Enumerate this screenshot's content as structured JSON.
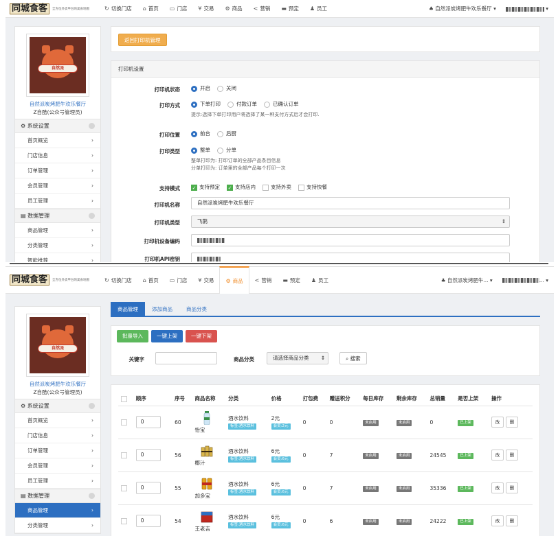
{
  "nav": {
    "logo_text": "同城食客",
    "logo_tagline": "全方位外卖平台的美食地图",
    "items": [
      {
        "icon": "refresh-icon",
        "glyph": "↻",
        "label": "切换门店"
      },
      {
        "icon": "home-icon",
        "glyph": "⌂",
        "label": "首页"
      },
      {
        "icon": "monitor-icon",
        "glyph": "▭",
        "label": "门店"
      },
      {
        "icon": "yen-icon",
        "glyph": "¥",
        "label": "交易"
      },
      {
        "icon": "goods-icon",
        "glyph": "⚙",
        "label": "商品"
      },
      {
        "icon": "share-icon",
        "glyph": "<",
        "label": "营销"
      },
      {
        "icon": "bookmark-icon",
        "glyph": "▬",
        "label": "预定"
      },
      {
        "icon": "user-icon",
        "glyph": "♟",
        "label": "员工"
      }
    ],
    "shop_selector_1": "自然派炭烤肥牛欢乐餐厅",
    "shop_selector_2": "自然派炭烤肥牛...",
    "account_2_visible_suffix": "..."
  },
  "sidebar": {
    "avatar_label": "自然派",
    "shop_name": "自然派炭烤肥牛欢乐餐厅",
    "role": "Z自酷(公众号管理员)",
    "sections": [
      {
        "label": "系统设置",
        "icon": "gear-icon",
        "items": [
          "首页概览",
          "门店信息",
          "订单管理",
          "会员管理",
          "员工管理"
        ]
      },
      {
        "label": "数据管理",
        "icon": "database-icon",
        "items": [
          "商品管理",
          "分类管理",
          "智能推荐"
        ]
      }
    ]
  },
  "printer": {
    "back_button": "返回打印机管理",
    "panel_title": "打印机设置",
    "status_label": "打印机状态",
    "status_options": [
      "开启",
      "关闭"
    ],
    "method_label": "打印方式",
    "method_options": [
      "下单打印",
      "付款订单",
      "已确认订单"
    ],
    "method_hint": "提示:选择下单打印用户将选择了某一种支付方式后才会打印.",
    "position_label": "打印位置",
    "position_options": [
      "前台",
      "后厨"
    ],
    "type_label": "打印类型",
    "type_options": [
      "整单",
      "分单"
    ],
    "type_hint_1": "整单打印为:   打印订单的全部产品条目信息",
    "type_hint_2": "分单打印为:   订单里的全部产品每个打印一次",
    "mode_label": "支持模式",
    "modes": [
      {
        "label": "支持预定",
        "checked": true
      },
      {
        "label": "支持店内",
        "checked": true
      },
      {
        "label": "支持外卖",
        "checked": false
      },
      {
        "label": "支持快餐",
        "checked": false
      }
    ],
    "name_label": "打印机名称",
    "name_value": "自然派炭烤肥牛欢乐餐厅",
    "model_label": "打印机类型",
    "model_value": "飞鹅",
    "code_label": "打印机设备编码",
    "key_label": "打印机API密钥"
  },
  "goods": {
    "tabs": [
      "商品管理",
      "添加商品",
      "商品分类"
    ],
    "buttons": {
      "import": "批量导入",
      "on_shelf": "一键上架",
      "off_shelf": "一键下架",
      "search": "搜索"
    },
    "keyword_label": "关键字",
    "category_label": "商品分类",
    "category_placeholder": "请选择商品分类",
    "columns": [
      "顺序",
      "序号",
      "商品名称",
      "分类",
      "价格",
      "打包费",
      "赠送积分",
      "每日库存",
      "剩余库存",
      "总销量",
      "是否上架",
      "操作"
    ],
    "rows": [
      {
        "order": "0",
        "id": "60",
        "name": "怡宝",
        "category": "酒水饮料",
        "cat_tag": "标签:酒水饮料",
        "price": "2元",
        "member_tag": "会员:2元",
        "pack": "0",
        "points": "0",
        "daily": "未启用",
        "remain": "未启用",
        "sales": "0",
        "status": "已上架"
      },
      {
        "order": "0",
        "id": "56",
        "name": "椰汁",
        "category": "酒水饮料",
        "cat_tag": "标签:酒水饮料",
        "price": "6元",
        "member_tag": "会员:6元",
        "pack": "0",
        "points": "7",
        "daily": "未启用",
        "remain": "未启用",
        "sales": "24545",
        "status": "已上架"
      },
      {
        "order": "0",
        "id": "55",
        "name": "加多宝",
        "category": "酒水饮料",
        "cat_tag": "标签:酒水饮料",
        "price": "6元",
        "member_tag": "会员:6元",
        "pack": "0",
        "points": "7",
        "daily": "未启用",
        "remain": "未启用",
        "sales": "35336",
        "status": "已上架"
      },
      {
        "order": "0",
        "id": "54",
        "name": "王老吉",
        "category": "酒水饮料",
        "cat_tag": "标签:酒水饮料",
        "price": "6元",
        "member_tag": "会员:6元",
        "pack": "0",
        "points": "6",
        "daily": "未启用",
        "remain": "未启用",
        "sales": "24222",
        "status": "已上架"
      }
    ],
    "action_edit": "改",
    "action_delete": "删"
  },
  "colors": {
    "accent": "#2d6fc1",
    "orange": "#f08a24",
    "green": "#5cb85c",
    "red": "#d9534f"
  }
}
